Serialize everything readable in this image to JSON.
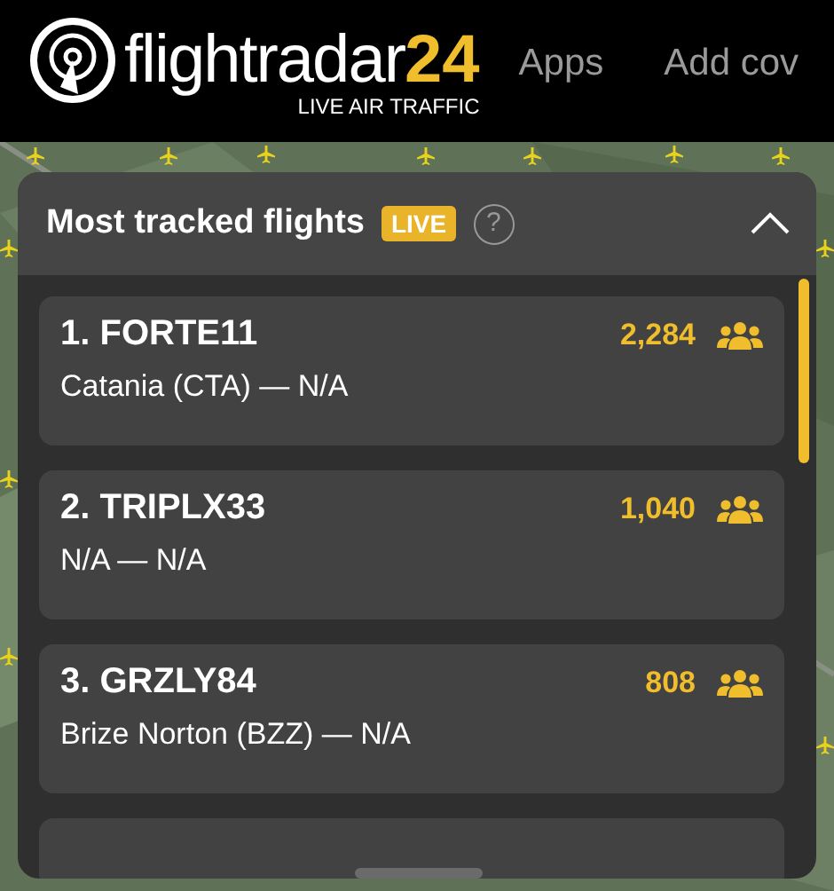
{
  "header": {
    "logo_text": "flightradar",
    "logo_number": "24",
    "tagline": "LIVE AIR TRAFFIC",
    "nav": [
      "Apps",
      "Add cov"
    ]
  },
  "panel": {
    "title": "Most tracked flights",
    "badge": "LIVE",
    "help": "?",
    "expanded": true,
    "flights": [
      {
        "rank_callsign": "1. FORTE11",
        "route": "Catania (CTA) — N/A",
        "count": "2,284"
      },
      {
        "rank_callsign": "2. TRIPLX33",
        "route": "N/A — N/A",
        "count": "1,040"
      },
      {
        "rank_callsign": "3. GRZLY84",
        "route": "Brize Norton (BZZ) — N/A",
        "count": "808"
      }
    ]
  }
}
